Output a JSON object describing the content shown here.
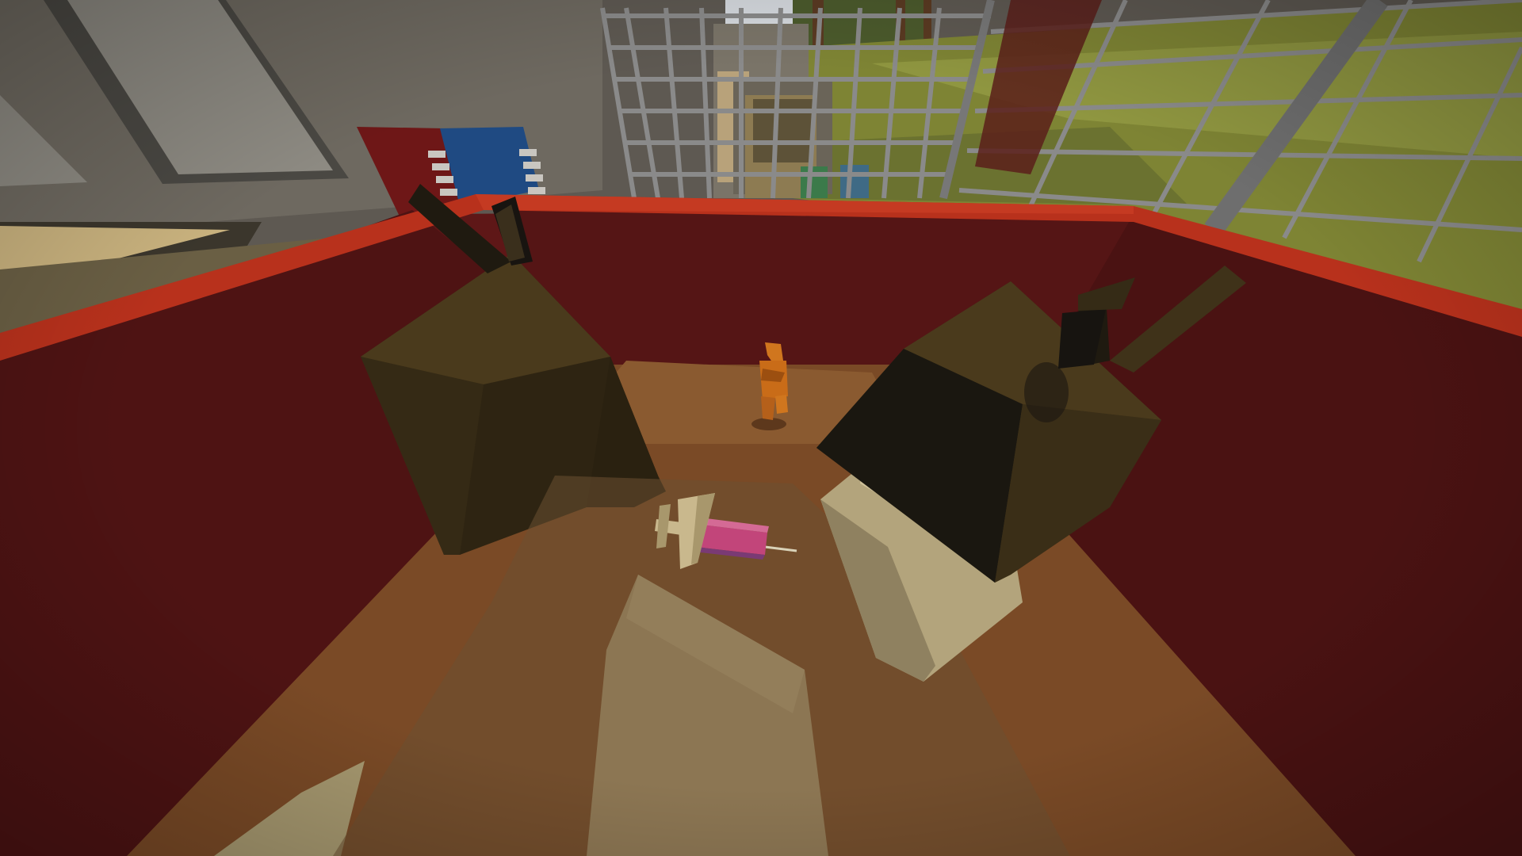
{
  "scene": {
    "palette": {
      "dumpster_rim": "#b8311c",
      "dumpster_wall": "#5e1717",
      "dumpster_floor": "#7a4a26",
      "trash_bag": "#3f3219",
      "bag_knot": "#1f1a10",
      "cardboard": "#b3a47c",
      "grass": "#8a8f3a",
      "fence": "#8a8a8a",
      "building_wall": "#6a6358",
      "syringe_body": "#c2457a",
      "figure": "#d0761e"
    },
    "objects": [
      {
        "name": "dumpster",
        "icon": "dumpster-icon"
      },
      {
        "name": "trash-bag-left",
        "icon": "trash-bag-icon"
      },
      {
        "name": "trash-bag-right",
        "icon": "trash-bag-icon"
      },
      {
        "name": "syringe",
        "icon": "syringe-icon"
      },
      {
        "name": "cardboard-pieces",
        "icon": "box-icon"
      },
      {
        "name": "distant-zombie",
        "icon": "person-icon"
      },
      {
        "name": "chain-link-fence",
        "icon": "fence-icon"
      }
    ]
  }
}
